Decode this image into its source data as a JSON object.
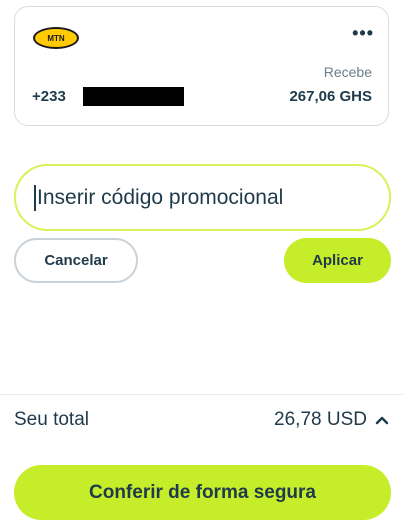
{
  "recipient_card": {
    "logo_text": "MTN",
    "more_icon": "more-horizontal-icon",
    "receives_label": "Recebe",
    "phone_prefix": "+233",
    "amount": "267,06 GHS"
  },
  "promo": {
    "placeholder": "Inserir código promocional",
    "value": "",
    "cancel_label": "Cancelar",
    "apply_label": "Aplicar"
  },
  "total": {
    "label": "Seu total",
    "value": "26,78 USD",
    "toggle_icon": "chevron-up-icon"
  },
  "checkout": {
    "label": "Conferir de forma segura"
  },
  "colors": {
    "accent": "#c6ed2a",
    "text": "#1f3a4a",
    "muted": "#6b7e8a"
  }
}
